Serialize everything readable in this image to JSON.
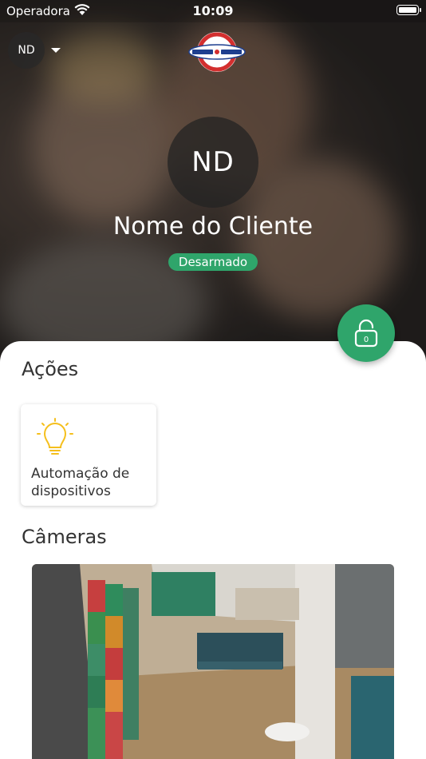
{
  "status_bar": {
    "carrier": "Operadora",
    "time": "10:09"
  },
  "header": {
    "account_initials": "ND",
    "logo_text": "ALARM SYSTEMS"
  },
  "profile": {
    "initials": "ND",
    "name": "Nome do Cliente",
    "status": "Desarmado",
    "status_color": "#2fa56b"
  },
  "fab": {
    "count": "0"
  },
  "actions": {
    "title": "Ações",
    "items": [
      {
        "label": "Automação de dispositivos",
        "icon": "lightbulb-icon"
      }
    ]
  },
  "cameras": {
    "title": "Câmeras"
  }
}
